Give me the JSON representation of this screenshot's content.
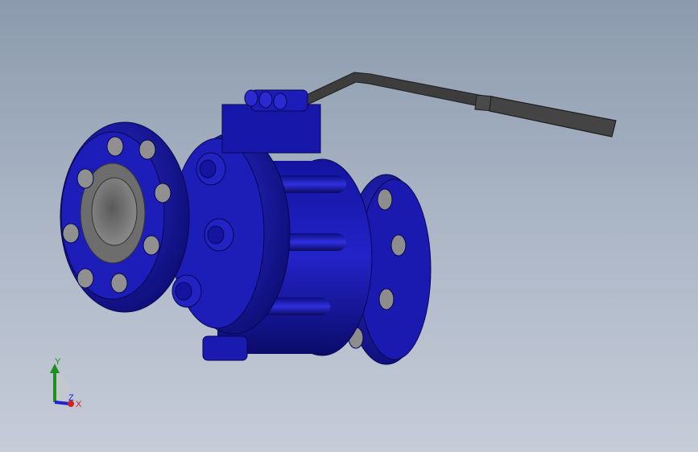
{
  "viewport": {
    "background_top": "#8b9aad",
    "background_bottom": "#c6ccd8",
    "model": "ball-valve",
    "body_color": "#1a1aa8",
    "handle_color": "#3a3a3a",
    "bore_color": "#7a7a7a"
  },
  "triad": {
    "y_label": "Y",
    "x_label": "X",
    "z_label": "Z",
    "y_color": "#1f8f1f",
    "x_color": "#cc2222",
    "z_color": "#2222cc"
  }
}
